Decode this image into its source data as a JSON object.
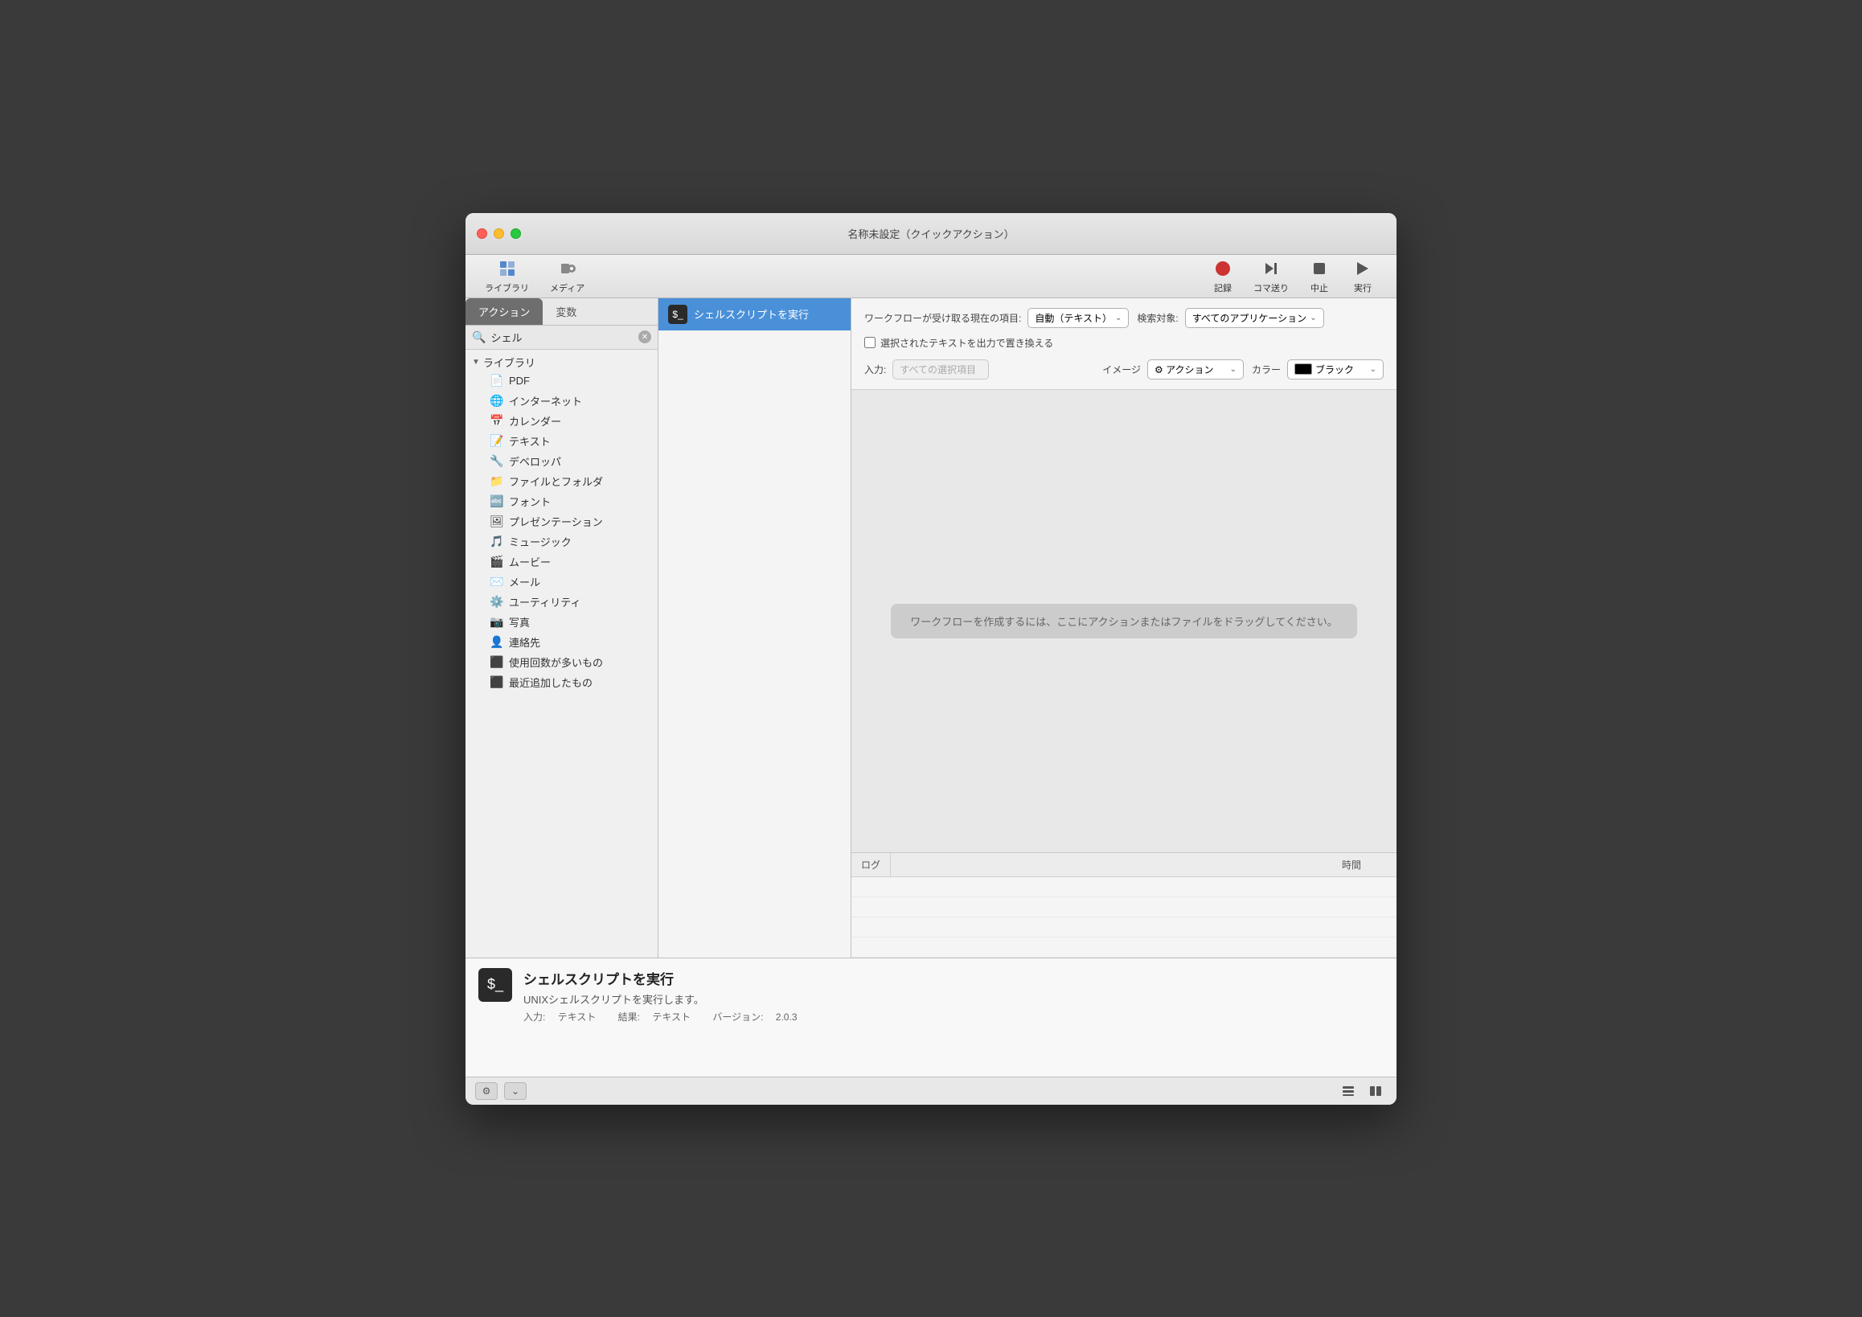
{
  "window": {
    "title": "名称未設定（クイックアクション）"
  },
  "toolbar": {
    "library_label": "ライブラリ",
    "media_label": "メディア",
    "record_label": "記録",
    "step_label": "コマ送り",
    "stop_label": "中止",
    "run_label": "実行"
  },
  "sidebar": {
    "tab_actions": "アクション",
    "tab_variables": "変数",
    "search_placeholder": "シェル",
    "library_label": "ライブラリ",
    "items": [
      {
        "label": "PDF",
        "icon": "📄"
      },
      {
        "label": "インターネット",
        "icon": "🌐"
      },
      {
        "label": "カレンダー",
        "icon": "📅"
      },
      {
        "label": "テキスト",
        "icon": "📝"
      },
      {
        "label": "デベロッパ",
        "icon": "🔧"
      },
      {
        "label": "ファイルとフォルダ",
        "icon": "📁"
      },
      {
        "label": "フォント",
        "icon": "🔤"
      },
      {
        "label": "プレゼンテーション",
        "icon": "🖼"
      },
      {
        "label": "ミュージック",
        "icon": "🎵"
      },
      {
        "label": "ムービー",
        "icon": "🎬"
      },
      {
        "label": "メール",
        "icon": "✉️"
      },
      {
        "label": "ユーティリティ",
        "icon": "⚙️"
      },
      {
        "label": "写真",
        "icon": "📷"
      },
      {
        "label": "連絡先",
        "icon": "👤"
      },
      {
        "label": "使用回数が多いもの",
        "icon": "⭐"
      },
      {
        "label": "最近追加したもの",
        "icon": "🕐"
      }
    ]
  },
  "results": {
    "items": [
      {
        "label": "シェルスクリプトを実行",
        "selected": true
      }
    ]
  },
  "config": {
    "workflow_label": "ワークフローが受け取る現在の項目:",
    "workflow_value": "自動（テキスト）",
    "search_target_label": "検索対象:",
    "search_target_value": "すべてのアプリケーション",
    "input_label": "入力:",
    "input_placeholder": "すべての選択項目",
    "checkbox_label": "選択されたテキストを出力で置き換える",
    "image_label": "イメージ",
    "image_value": "⚙ アクション",
    "color_label": "カラー",
    "color_value": "ブラック",
    "color_hex": "#000000"
  },
  "canvas": {
    "drop_hint": "ワークフローを作成するには、ここにアクションまたはファイルをドラッグしてください。"
  },
  "log": {
    "col_log": "ログ",
    "col_time": "時間"
  },
  "bottom_panel": {
    "title": "シェルスクリプトを実行",
    "description": "UNIXシェルスクリプトを実行します。",
    "input_label": "入力:",
    "input_value": "テキスト",
    "result_label": "結果:",
    "result_value": "テキスト",
    "version_label": "バージョン:",
    "version_value": "2.0.3"
  }
}
